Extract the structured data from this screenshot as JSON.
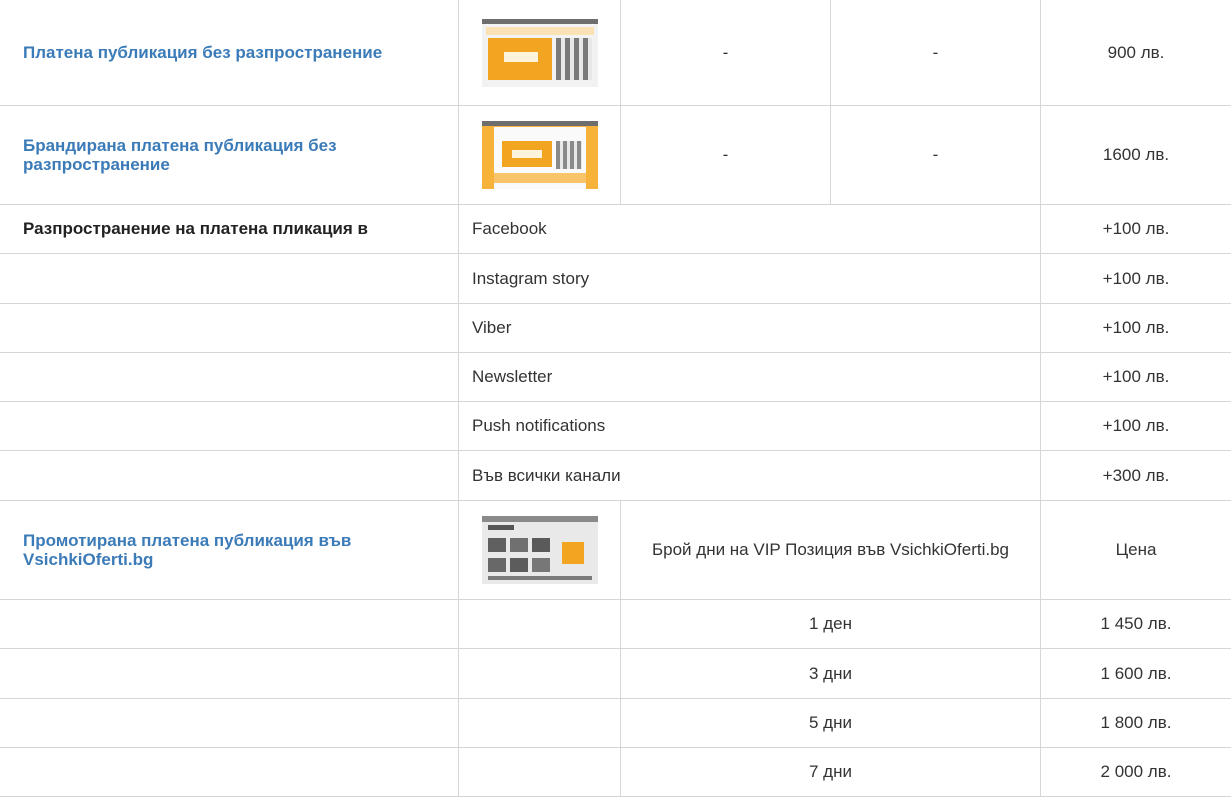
{
  "paid_publication": {
    "title": "Платена публикация без разпространение",
    "col2": "-",
    "col3": "-",
    "price": "900 лв."
  },
  "branded_publication": {
    "title": "Брандирана платена публикация без разпространение",
    "col2": "-",
    "col3": "-",
    "price": "1600 лв."
  },
  "distribution": {
    "label": "Разпространение на платена пликация в",
    "channels": [
      {
        "name": "Facebook",
        "price": "+100 лв."
      },
      {
        "name": "Instagram story",
        "price": "+100 лв."
      },
      {
        "name": "Viber",
        "price": "+100 лв."
      },
      {
        "name": "Newsletter",
        "price": "+100 лв."
      },
      {
        "name": "Push notifications",
        "price": "+100 лв."
      },
      {
        "name": "Във всички канали",
        "price": "+300 лв."
      }
    ]
  },
  "promoted_publication": {
    "title": "Промотирана платена публикация във VsichkiOferti.bg",
    "days_header": "Брой дни на VIP Позиция във VsichkiOferti.bg",
    "price_header": "Цена",
    "options": [
      {
        "days": "1 ден",
        "price": "1 450 лв."
      },
      {
        "days": "3 дни",
        "price": "1 600 лв."
      },
      {
        "days": "5 дни",
        "price": "1 800 лв."
      },
      {
        "days": "7 дни",
        "price": "2 000 лв."
      }
    ]
  }
}
